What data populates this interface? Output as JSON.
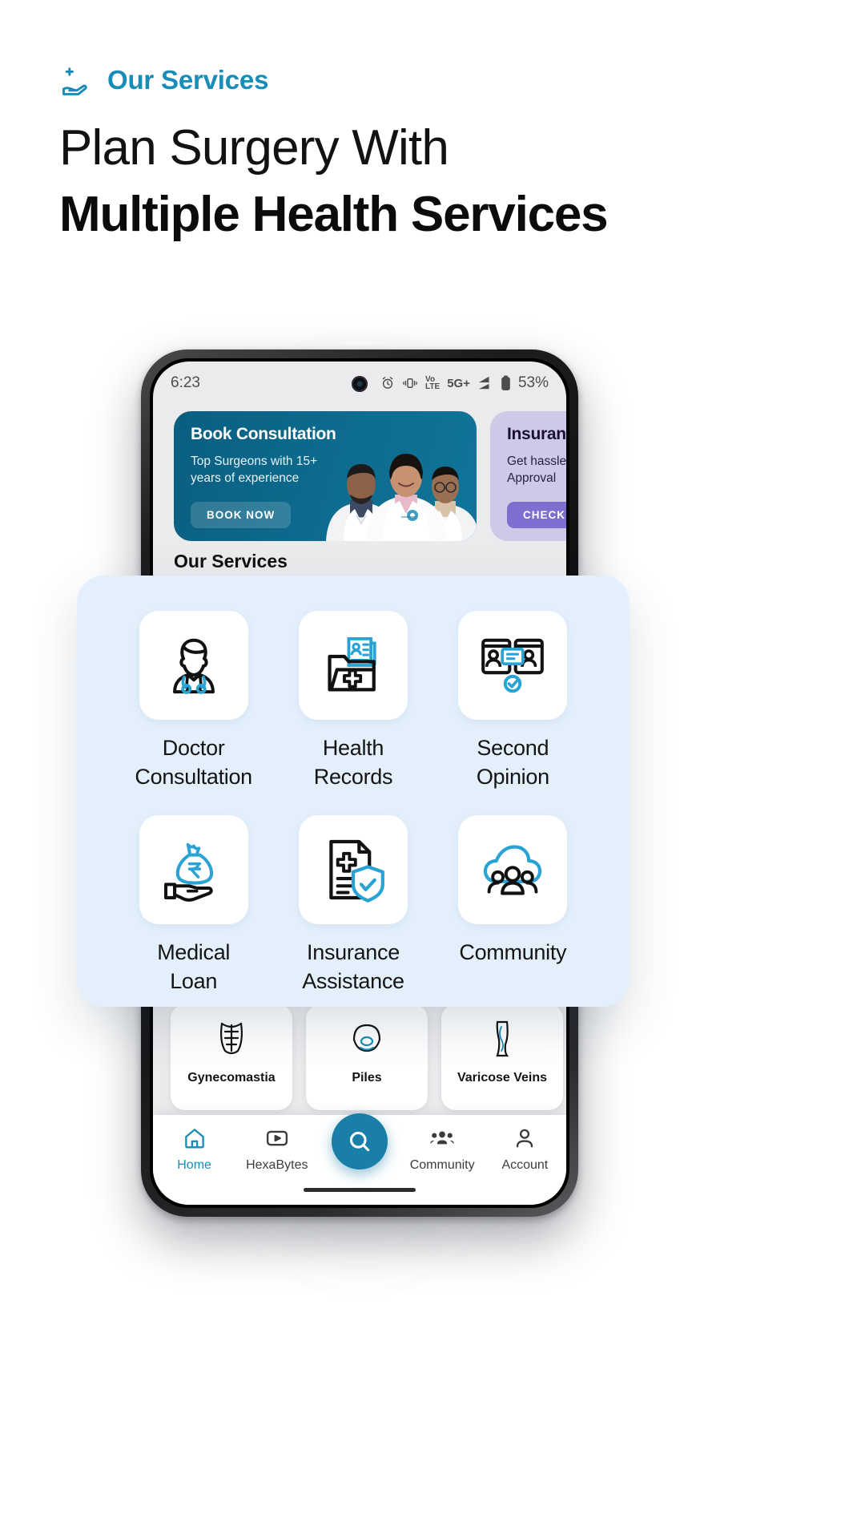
{
  "page": {
    "kicker": "Our Services",
    "kicker_icon": "hand-holding-plus-icon",
    "headline_line1": "Plan Surgery With",
    "headline_line2": "Multiple Health Services",
    "accent_color": "#1a8cb8",
    "overlay_bg": "#e3f0fc"
  },
  "phone": {
    "statusbar": {
      "time": "6:23",
      "alarm_icon": "alarm-clock-icon",
      "vibrate_icon": "vibrate-icon",
      "volte_line1": "Vo",
      "volte_line2": "LTE",
      "network": "5G+",
      "signal_icon": "signal-bars-icon",
      "battery_icon": "battery-icon",
      "battery": "53%"
    },
    "banners": [
      {
        "title": "Book Consultation",
        "subtitle": "Top Surgeons with 15+ years of experience",
        "button": "BOOK NOW",
        "bg": "#0e6c8f",
        "image": "three-doctors-photo"
      },
      {
        "title": "Insurance",
        "subtitle": "Get hassle-free Approval",
        "button": "CHECK",
        "bg": "#cfc9e8"
      }
    ],
    "services_heading": "Our Services",
    "procedures": [
      {
        "label": "Gynecomastia",
        "icon": "chest-icon"
      },
      {
        "label": "Piles",
        "icon": "piles-icon"
      },
      {
        "label": "Varicose Veins",
        "icon": "leg-vein-icon"
      }
    ],
    "bottom_nav": [
      {
        "label": "Home",
        "icon": "home-icon",
        "active": true
      },
      {
        "label": "HexaBytes",
        "icon": "video-play-icon",
        "active": false
      },
      {
        "label": "",
        "icon": "search-icon",
        "active": false
      },
      {
        "label": "Community",
        "icon": "people-group-icon",
        "active": false
      },
      {
        "label": "Account",
        "icon": "person-icon",
        "active": false
      }
    ]
  },
  "services_overlay": {
    "items": [
      {
        "label": "Doctor\nConsultation",
        "line1": "Doctor",
        "line2": "Consultation",
        "icon": "doctor-icon"
      },
      {
        "label": "Health Records",
        "line1": "Health",
        "line2": "Records",
        "icon": "health-records-folder-icon"
      },
      {
        "label": "Second Opinion",
        "line1": "Second",
        "line2": "Opinion",
        "icon": "second-opinion-video-icon"
      },
      {
        "label": "Medical Loan",
        "line1": "Medical",
        "line2": "Loan",
        "icon": "money-bag-hand-icon"
      },
      {
        "label": "Insurance Assistance",
        "line1": "Insurance",
        "line2": "Assistance",
        "icon": "document-shield-icon"
      },
      {
        "label": "Community",
        "line1": "Community",
        "line2": "",
        "icon": "community-people-icon"
      }
    ]
  }
}
